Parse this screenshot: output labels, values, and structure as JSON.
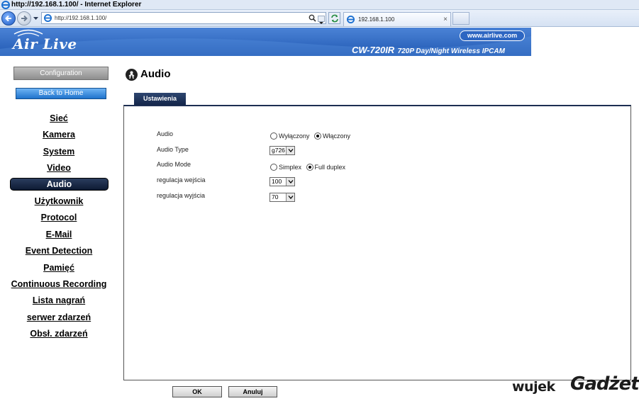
{
  "browser": {
    "window_title": "http://192.168.1.100/ - Internet Explorer",
    "address": "http://192.168.1.100/",
    "tab_title": "192.168.1.100",
    "tab_close": "×"
  },
  "banner": {
    "logo": "Air Live",
    "website": "www.airlive.com",
    "model_code": "CW-720IR",
    "model_desc": "720P Day/Night Wireless IPCAM"
  },
  "sidebar": {
    "configuration": "Configuration",
    "back_home": "Back to Home",
    "items": [
      {
        "label": "Sieć"
      },
      {
        "label": "Kamera"
      },
      {
        "label": "System"
      },
      {
        "label": "Video"
      },
      {
        "label": "Audio"
      },
      {
        "label": "Użytkownik"
      },
      {
        "label": "Protocol"
      },
      {
        "label": "E-Mail"
      },
      {
        "label": "Event Detection"
      },
      {
        "label": "Pamięć"
      },
      {
        "label": "Continuous Recording"
      },
      {
        "label": "Lista nagrań"
      },
      {
        "label": "serwer zdarzeń"
      },
      {
        "label": "Obsł. zdarzeń"
      }
    ],
    "active_index": 4
  },
  "page": {
    "title": "Audio",
    "tab": "Ustawienia"
  },
  "form": {
    "audio": {
      "label": "Audio",
      "options": [
        "Wyłączony",
        "Włączony"
      ],
      "selected": "Włączony"
    },
    "audio_type": {
      "label": "Audio Type",
      "value": "g726"
    },
    "audio_mode": {
      "label": "Audio Mode",
      "options": [
        "Simplex",
        "Full duplex"
      ],
      "selected": "Full duplex"
    },
    "input_gain": {
      "label": "regulacja wejścia",
      "value": "100"
    },
    "output_gain": {
      "label": "regulacja wyjścia",
      "value": "70"
    }
  },
  "buttons": {
    "ok": "OK",
    "cancel": "Anuluj"
  },
  "watermark": {
    "part1": "wujek",
    "part2": "Gadżet"
  },
  "colors": {
    "banner_blue": "#2d66c2",
    "active_nav": "#14264a",
    "home_button": "#1f73cc"
  }
}
